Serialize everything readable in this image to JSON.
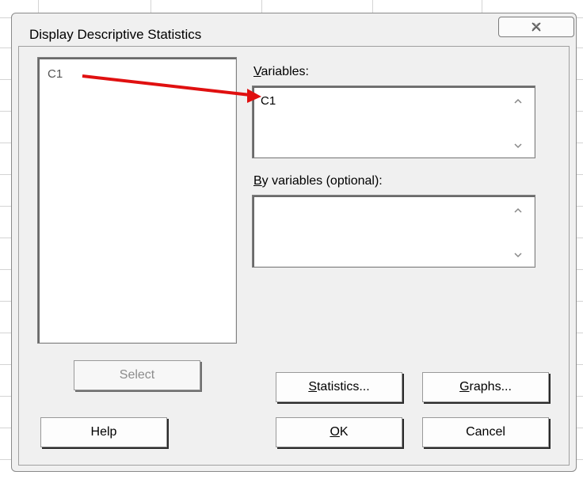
{
  "dialog": {
    "title": "Display Descriptive Statistics"
  },
  "source_list": {
    "items": [
      "C1"
    ]
  },
  "variables": {
    "label": "Variables:",
    "value": "C1"
  },
  "by_variables": {
    "label": "By variables (optional):",
    "value": ""
  },
  "buttons": {
    "select": "Select",
    "statistics": "Statistics...",
    "graphs": "Graphs...",
    "help": "Help",
    "ok": "OK",
    "cancel": "Cancel"
  },
  "colors": {
    "annotation_arrow": "#e01010"
  },
  "icons": {
    "close": "close-x-icon",
    "scroll_up": "scroll-up-arrow-icon",
    "scroll_down": "scroll-down-arrow-icon"
  }
}
